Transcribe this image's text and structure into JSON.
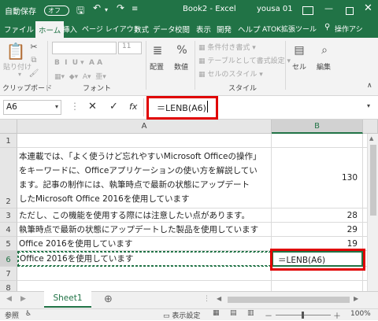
{
  "titlebar": {
    "autosave_label": "自動保存",
    "autosave_state": "オフ",
    "title": "Book2 - Excel",
    "user": "yousa 01"
  },
  "menu_tabs": [
    "ファイル",
    "ホーム",
    "挿入",
    "ページ レイアウト",
    "数式",
    "データ",
    "校閲",
    "表示",
    "開発",
    "ヘルプ",
    "ATOK拡張ツール"
  ],
  "menu_search": "操作アシ",
  "ribbon": {
    "paste_label": "貼り付け",
    "clipboard_label": "クリップボード",
    "font_size": "11",
    "font_group_label": "フォント",
    "alignment_label": "配置",
    "number_label": "数値",
    "conditional_format": "条件付き書式",
    "table_format": "テーブルとして書式設定",
    "cell_styles": "セルのスタイル",
    "style_group_label": "スタイル",
    "cells_label": "セル",
    "edit_label": "編集"
  },
  "formula_bar": {
    "name_box": "A6",
    "fx": "fx",
    "formula": "＝LENB(A6)"
  },
  "grid": {
    "col_headers": [
      "A",
      "B"
    ],
    "rows": [
      {
        "num": "1",
        "a_lines": [],
        "b": ""
      },
      {
        "num": "2",
        "a_lines": [
          "本連載では、「よく使うけど忘れやすいMicrosoft Officeの操作」",
          "をキーワードに、Officeアプリケーションの使い方を解説してい",
          "ます。記事の制作には、執筆時点で最新の状態にアップデート",
          "したMicrosoft Office 2016を使用しています"
        ],
        "b": "130"
      },
      {
        "num": "3",
        "a_lines": [
          "ただし、この機能を使用する際には注意したい点があります。"
        ],
        "b": "28"
      },
      {
        "num": "4",
        "a_lines": [
          "執筆時点で最新の状態にアップデートした製品を使用しています"
        ],
        "b": "29"
      },
      {
        "num": "5",
        "a_lines": [
          "Office 2016を使用しています"
        ],
        "b": "19"
      },
      {
        "num": "6",
        "a_lines": [
          "Office 2016を使用しています"
        ],
        "b": "＝LENB(A6)"
      },
      {
        "num": "7",
        "a_lines": [],
        "b": ""
      },
      {
        "num": "8",
        "a_lines": [],
        "b": ""
      }
    ]
  },
  "sheet_tabs": {
    "active": "Sheet1",
    "add": "⊕"
  },
  "status": {
    "mode": "参照",
    "display_settings": "表示設定",
    "zoom": "100%"
  },
  "colors": {
    "accent": "#217346",
    "highlight": "#e00000"
  }
}
